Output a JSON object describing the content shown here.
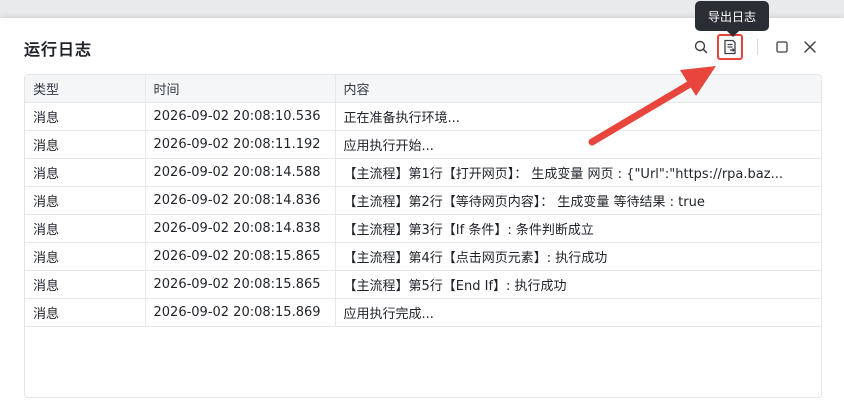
{
  "window": {
    "title": "运行日志"
  },
  "toolbar": {
    "export_tooltip": "导出日志",
    "icons": [
      "search-icon",
      "export-log-icon",
      "maximize-icon",
      "close-icon"
    ],
    "accent": "#e8453c"
  },
  "table": {
    "columns": [
      "类型",
      "时间",
      "内容"
    ],
    "rows": [
      {
        "type": "消息",
        "time": "2026-09-02 20:08:10.536",
        "content": "正在准备执行环境..."
      },
      {
        "type": "消息",
        "time": "2026-09-02 20:08:11.192",
        "content": "应用执行开始..."
      },
      {
        "type": "消息",
        "time": "2026-09-02 20:08:14.588",
        "content": "【主流程】第1行【打开网页】： 生成变量 网页 : {\"Url\":\"https://rpa.baz..."
      },
      {
        "type": "消息",
        "time": "2026-09-02 20:08:14.836",
        "content": "【主流程】第2行【等待网页内容】： 生成变量 等待结果 : true"
      },
      {
        "type": "消息",
        "time": "2026-09-02 20:08:14.838",
        "content": "【主流程】第3行【If 条件】: 条件判断成立"
      },
      {
        "type": "消息",
        "time": "2026-09-02 20:08:15.865",
        "content": "【主流程】第4行【点击网页元素】: 执行成功"
      },
      {
        "type": "消息",
        "time": "2026-09-02 20:08:15.865",
        "content": "【主流程】第5行【End If】: 执行成功"
      },
      {
        "type": "消息",
        "time": "2026-09-02 20:08:15.869",
        "content": "应用执行完成..."
      }
    ]
  }
}
